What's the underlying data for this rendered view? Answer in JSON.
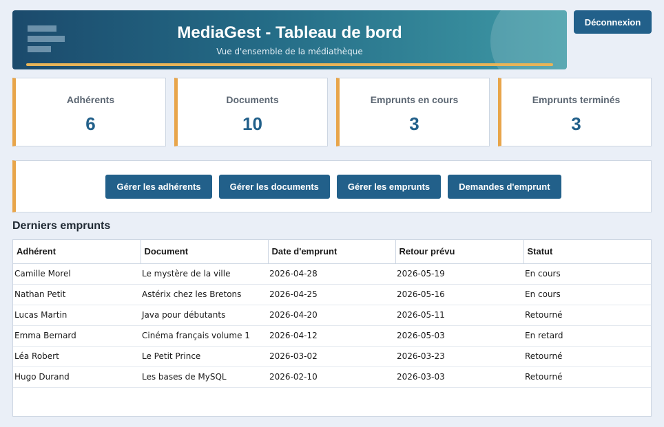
{
  "header": {
    "title": "MediaGest - Tableau de bord",
    "subtitle": "Vue d'ensemble de la médiathèque",
    "logout_label": "Déconnexion"
  },
  "stats": [
    {
      "label": "Adhérents",
      "value": "6"
    },
    {
      "label": "Documents",
      "value": "10"
    },
    {
      "label": "Emprunts en cours",
      "value": "3"
    },
    {
      "label": "Emprunts terminés",
      "value": "3"
    }
  ],
  "actions": [
    {
      "label": "Gérer les adhérents"
    },
    {
      "label": "Gérer les documents"
    },
    {
      "label": "Gérer les emprunts"
    },
    {
      "label": "Demandes d'emprunt"
    }
  ],
  "loans": {
    "title": "Derniers emprunts",
    "columns": [
      "Adhérent",
      "Document",
      "Date d'emprunt",
      "Retour prévu",
      "Statut"
    ],
    "rows": [
      [
        "Camille Morel",
        "Le mystère de la ville",
        "2026-04-28",
        "2026-05-19",
        "En cours"
      ],
      [
        "Nathan Petit",
        "Astérix chez les Bretons",
        "2026-04-25",
        "2026-05-16",
        "En cours"
      ],
      [
        "Lucas Martin",
        "Java pour débutants",
        "2026-04-20",
        "2026-05-11",
        "Retourné"
      ],
      [
        "Emma Bernard",
        "Cinéma français volume 1",
        "2026-04-12",
        "2026-05-03",
        "En retard"
      ],
      [
        "Léa Robert",
        "Le Petit Prince",
        "2026-03-02",
        "2026-03-23",
        "Retourné"
      ],
      [
        "Hugo Durand",
        "Les bases de MySQL",
        "2026-02-10",
        "2026-03-03",
        "Retourné"
      ]
    ]
  },
  "colors": {
    "accent": "#22608a",
    "highlight": "#e8a54a",
    "background": "#eaeff7"
  }
}
